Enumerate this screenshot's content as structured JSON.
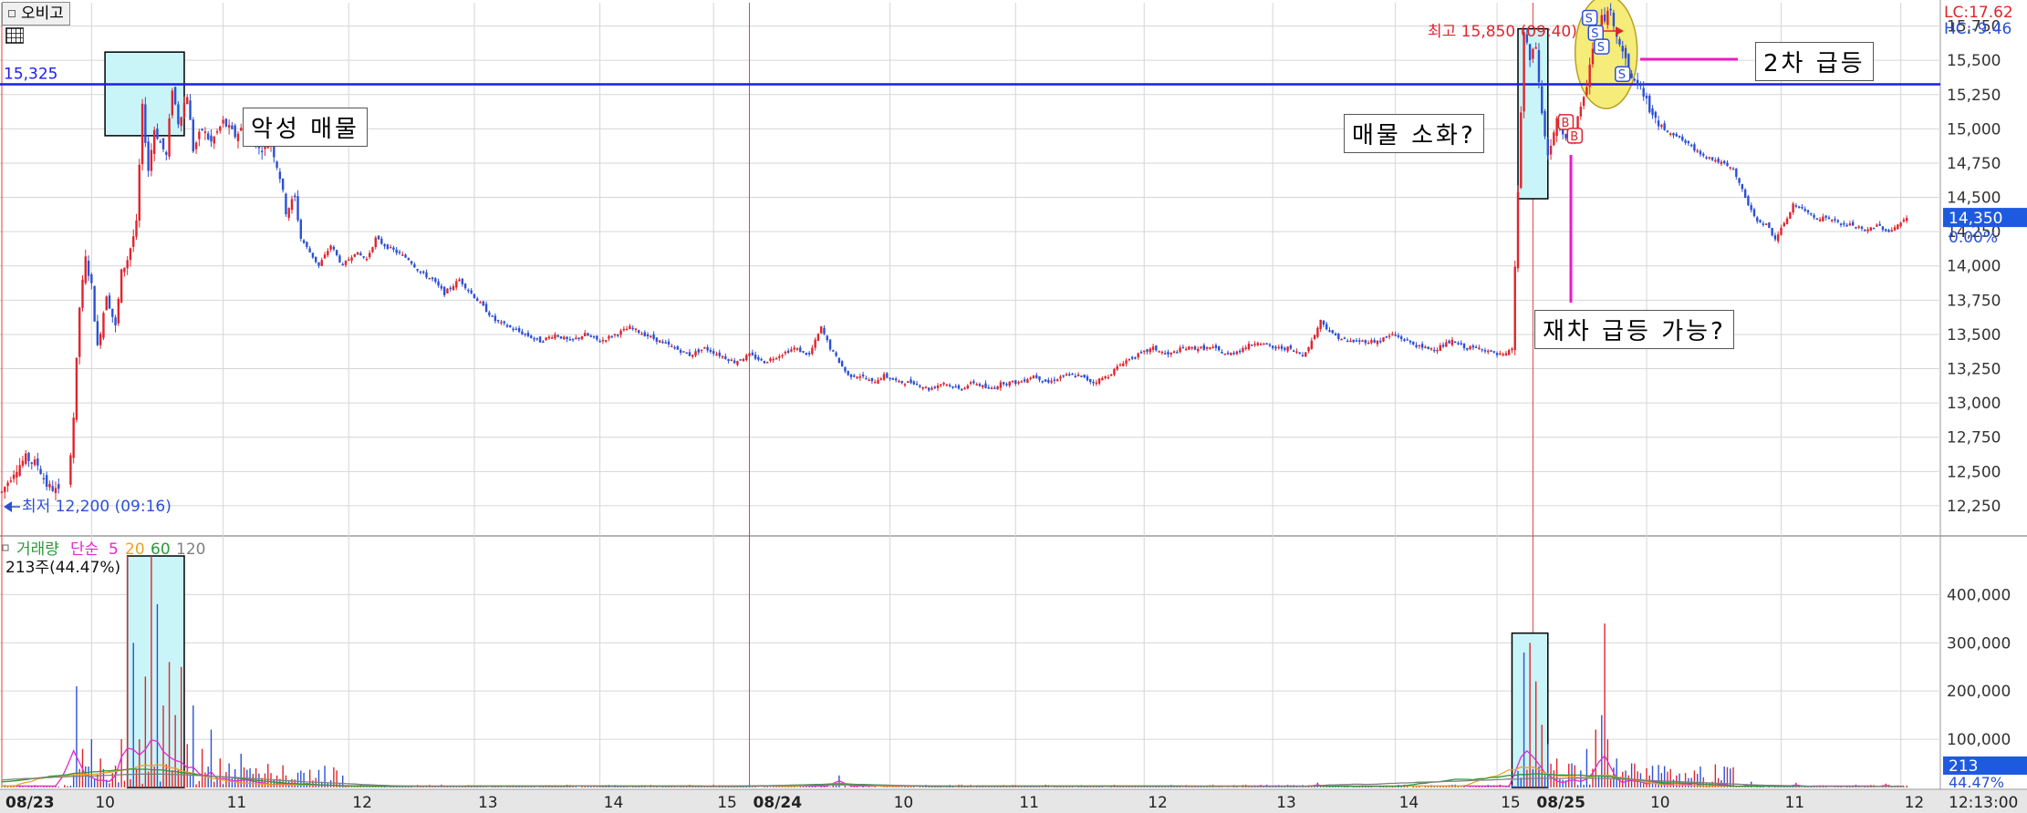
{
  "toolbar": {
    "compare_button": "오비고"
  },
  "colors": {
    "up": "#e0242c",
    "down": "#2b50d6",
    "ref_line": "#1c1cf0",
    "accent_pink": "#f018c8",
    "grid": "#d6d6d6",
    "session_line": "#e04040",
    "highlight_fill": "#c9f5f8",
    "ellipse_fill": "#f5ec7a",
    "ma5": "#e02ad0",
    "ma20": "#f0a020",
    "ma60": "#2a9a3a",
    "ma120": "#808080",
    "cur_price_box": "#1e5ae0"
  },
  "chart_data": [
    {
      "type": "candlestick",
      "title": "",
      "y_ticks": [
        12250,
        12500,
        12750,
        13000,
        13250,
        13500,
        13750,
        14000,
        14250,
        14500,
        14750,
        15000,
        15250,
        15500,
        15750
      ],
      "ylim": [
        12050,
        15920
      ],
      "ref_line": {
        "value": 15325,
        "label": "15,325"
      },
      "high_marker": {
        "label": "최고 15,850 (09:40)",
        "value": 15850
      },
      "low_marker": {
        "label": "최저 12,200 (09:16)",
        "value": 12200
      },
      "current_price": {
        "label": "14,350",
        "value": 14350,
        "change": "0.00%"
      },
      "top_right": {
        "lc": "LC:17.62",
        "hc": "HC:-9.46"
      },
      "annotations": [
        "악성 매물",
        "매물 소화?",
        "2차 급등",
        "재차 급등 가능?"
      ],
      "buy_markers": [
        "B",
        "B"
      ],
      "sell_markers": [
        "S",
        "S",
        "S",
        "S"
      ],
      "price_path": [
        [
          0,
          12350
        ],
        [
          8,
          12500
        ],
        [
          16,
          12600
        ],
        [
          24,
          12550
        ],
        [
          30,
          12400
        ],
        [
          38,
          12350
        ],
        [
          44,
          12400
        ],
        [
          48,
          12900
        ],
        [
          52,
          13700
        ],
        [
          56,
          14050
        ],
        [
          60,
          13850
        ],
        [
          64,
          13400
        ],
        [
          70,
          13800
        ],
        [
          76,
          13550
        ],
        [
          80,
          13950
        ],
        [
          84,
          14050
        ],
        [
          90,
          14300
        ],
        [
          94,
          15150
        ],
        [
          98,
          14700
        ],
        [
          102,
          15000
        ],
        [
          106,
          14900
        ],
        [
          110,
          14800
        ],
        [
          114,
          15300
        ],
        [
          118,
          15050
        ],
        [
          124,
          15250
        ],
        [
          128,
          14850
        ],
        [
          134,
          15000
        ],
        [
          140,
          14900
        ],
        [
          148,
          15050
        ],
        [
          156,
          14950
        ],
        [
          164,
          15050
        ],
        [
          172,
          14850
        ],
        [
          180,
          14900
        ],
        [
          186,
          14650
        ],
        [
          190,
          14400
        ],
        [
          196,
          14500
        ],
        [
          200,
          14200
        ],
        [
          206,
          14100
        ],
        [
          212,
          14000
        ],
        [
          220,
          14150
        ],
        [
          228,
          14000
        ],
        [
          236,
          14100
        ],
        [
          244,
          14050
        ],
        [
          250,
          14200
        ],
        [
          256,
          14150
        ],
        [
          264,
          14100
        ],
        [
          272,
          14050
        ],
        [
          280,
          13950
        ],
        [
          288,
          13900
        ],
        [
          296,
          13800
        ],
        [
          306,
          13900
        ],
        [
          314,
          13800
        ],
        [
          322,
          13700
        ],
        [
          330,
          13600
        ],
        [
          340,
          13550
        ],
        [
          350,
          13500
        ],
        [
          360,
          13450
        ],
        [
          370,
          13500
        ],
        [
          380,
          13450
        ],
        [
          390,
          13500
        ],
        [
          400,
          13450
        ],
        [
          410,
          13500
        ],
        [
          420,
          13550
        ],
        [
          430,
          13500
        ],
        [
          440,
          13450
        ],
        [
          450,
          13400
        ],
        [
          460,
          13350
        ],
        [
          470,
          13400
        ],
        [
          480,
          13350
        ],
        [
          490,
          13300
        ],
        [
          500,
          13350
        ],
        [
          510,
          13300
        ],
        [
          520,
          13350
        ],
        [
          530,
          13400
        ],
        [
          540,
          13350
        ],
        [
          548,
          13550
        ],
        [
          554,
          13400
        ],
        [
          560,
          13300
        ],
        [
          566,
          13200
        ],
        [
          574,
          13200
        ],
        [
          582,
          13150
        ],
        [
          590,
          13200
        ],
        [
          600,
          13150
        ],
        [
          610,
          13150
        ],
        [
          620,
          13100
        ],
        [
          630,
          13150
        ],
        [
          640,
          13100
        ],
        [
          650,
          13150
        ],
        [
          660,
          13100
        ],
        [
          670,
          13150
        ],
        [
          680,
          13150
        ],
        [
          690,
          13200
        ],
        [
          700,
          13150
        ],
        [
          710,
          13200
        ],
        [
          720,
          13200
        ],
        [
          730,
          13150
        ],
        [
          740,
          13200
        ],
        [
          750,
          13300
        ],
        [
          760,
          13350
        ],
        [
          770,
          13400
        ],
        [
          780,
          13350
        ],
        [
          790,
          13400
        ],
        [
          800,
          13400
        ],
        [
          810,
          13400
        ],
        [
          820,
          13350
        ],
        [
          830,
          13400
        ],
        [
          840,
          13450
        ],
        [
          850,
          13400
        ],
        [
          860,
          13400
        ],
        [
          870,
          13350
        ],
        [
          876,
          13450
        ],
        [
          882,
          13600
        ],
        [
          890,
          13500
        ],
        [
          900,
          13450
        ],
        [
          910,
          13450
        ],
        [
          920,
          13450
        ],
        [
          930,
          13500
        ],
        [
          940,
          13450
        ],
        [
          950,
          13400
        ],
        [
          960,
          13400
        ],
        [
          970,
          13450
        ],
        [
          980,
          13400
        ],
        [
          990,
          13400
        ],
        [
          1000,
          13350
        ],
        [
          1006,
          13350
        ],
        [
          1010,
          13400
        ],
        [
          1014,
          14550
        ],
        [
          1018,
          15700
        ],
        [
          1022,
          15500
        ],
        [
          1026,
          15600
        ],
        [
          1030,
          15100
        ],
        [
          1034,
          14800
        ],
        [
          1040,
          15050
        ],
        [
          1046,
          14900
        ],
        [
          1052,
          15000
        ],
        [
          1058,
          15200
        ],
        [
          1064,
          15600
        ],
        [
          1070,
          15800
        ],
        [
          1076,
          15850
        ],
        [
          1080,
          15700
        ],
        [
          1086,
          15500
        ],
        [
          1090,
          15350
        ],
        [
          1094,
          15350
        ],
        [
          1100,
          15200
        ],
        [
          1106,
          15050
        ],
        [
          1112,
          15000
        ],
        [
          1120,
          14950
        ],
        [
          1126,
          14900
        ],
        [
          1132,
          14850
        ],
        [
          1140,
          14800
        ],
        [
          1150,
          14750
        ],
        [
          1158,
          14700
        ],
        [
          1166,
          14500
        ],
        [
          1172,
          14350
        ],
        [
          1180,
          14300
        ],
        [
          1186,
          14200
        ],
        [
          1192,
          14300
        ],
        [
          1198,
          14450
        ],
        [
          1206,
          14400
        ],
        [
          1214,
          14350
        ],
        [
          1222,
          14350
        ],
        [
          1230,
          14300
        ],
        [
          1238,
          14300
        ],
        [
          1246,
          14250
        ],
        [
          1254,
          14300
        ],
        [
          1262,
          14250
        ],
        [
          1268,
          14300
        ],
        [
          1275,
          14350
        ]
      ]
    },
    {
      "type": "bar",
      "series_name": "거래량",
      "legend": [
        {
          "label": "거래량",
          "color": "#2a9a3a"
        },
        {
          "label": "단순",
          "color": "#e02ad0"
        },
        {
          "label": "5",
          "color": "#e02ad0"
        },
        {
          "label": "20",
          "color": "#f0a020"
        },
        {
          "label": "60",
          "color": "#2a9a3a"
        },
        {
          "label": "120",
          "color": "#808080"
        }
      ],
      "current_info": "213주(44.47%)",
      "y_ticks": [
        100000,
        200000,
        300000,
        400000
      ],
      "ylim": [
        0,
        480000
      ],
      "current_value": {
        "label": "213",
        "percent": "44.47%"
      },
      "volume_spikes": [
        [
          47,
          240000
        ],
        [
          50,
          210000
        ],
        [
          54,
          80000
        ],
        [
          60,
          100000
        ],
        [
          66,
          60000
        ],
        [
          74,
          30000
        ],
        [
          80,
          100000
        ],
        [
          84,
          480000
        ],
        [
          88,
          300000
        ],
        [
          92,
          100000
        ],
        [
          96,
          230000
        ],
        [
          100,
          480000
        ],
        [
          104,
          380000
        ],
        [
          108,
          170000
        ],
        [
          112,
          260000
        ],
        [
          116,
          150000
        ],
        [
          120,
          250000
        ],
        [
          124,
          90000
        ],
        [
          128,
          170000
        ],
        [
          134,
          80000
        ],
        [
          140,
          120000
        ],
        [
          146,
          60000
        ],
        [
          152,
          50000
        ],
        [
          160,
          70000
        ],
        [
          170,
          40000
        ],
        [
          180,
          30000
        ],
        [
          190,
          25000
        ],
        [
          200,
          35000
        ],
        [
          210,
          20000
        ],
        [
          220,
          15000
        ],
        [
          560,
          25000
        ],
        [
          880,
          10000
        ],
        [
          1018,
          280000
        ],
        [
          1022,
          300000
        ],
        [
          1026,
          220000
        ],
        [
          1030,
          130000
        ],
        [
          1034,
          90000
        ],
        [
          1040,
          60000
        ],
        [
          1050,
          50000
        ],
        [
          1060,
          80000
        ],
        [
          1066,
          120000
        ],
        [
          1070,
          150000
        ],
        [
          1072,
          340000
        ],
        [
          1074,
          100000
        ],
        [
          1080,
          60000
        ],
        [
          1090,
          50000
        ],
        [
          1100,
          40000
        ],
        [
          1110,
          30000
        ],
        [
          1120,
          25000
        ],
        [
          1130,
          20000
        ],
        [
          1150,
          15000
        ],
        [
          1170,
          12000
        ],
        [
          1200,
          10000
        ],
        [
          1260,
          8000
        ]
      ]
    }
  ],
  "x_axis": {
    "ticks": [
      {
        "idx": 0,
        "label": "08/23",
        "major": true
      },
      {
        "idx": 60,
        "label": "10"
      },
      {
        "idx": 148,
        "label": "11"
      },
      {
        "idx": 232,
        "label": "12"
      },
      {
        "idx": 316,
        "label": "13"
      },
      {
        "idx": 400,
        "label": "14"
      },
      {
        "idx": 476,
        "label": "15"
      },
      {
        "idx": 500,
        "label": "08/24",
        "major": true
      },
      {
        "idx": 594,
        "label": "10"
      },
      {
        "idx": 678,
        "label": "11"
      },
      {
        "idx": 764,
        "label": "12"
      },
      {
        "idx": 850,
        "label": "13"
      },
      {
        "idx": 932,
        "label": "14"
      },
      {
        "idx": 1000,
        "label": "15"
      },
      {
        "idx": 1024,
        "label": "08/25",
        "major": true
      },
      {
        "idx": 1100,
        "label": "10"
      },
      {
        "idx": 1190,
        "label": "11"
      },
      {
        "idx": 1270,
        "label": "12"
      }
    ],
    "right_label": "12:13:00"
  }
}
